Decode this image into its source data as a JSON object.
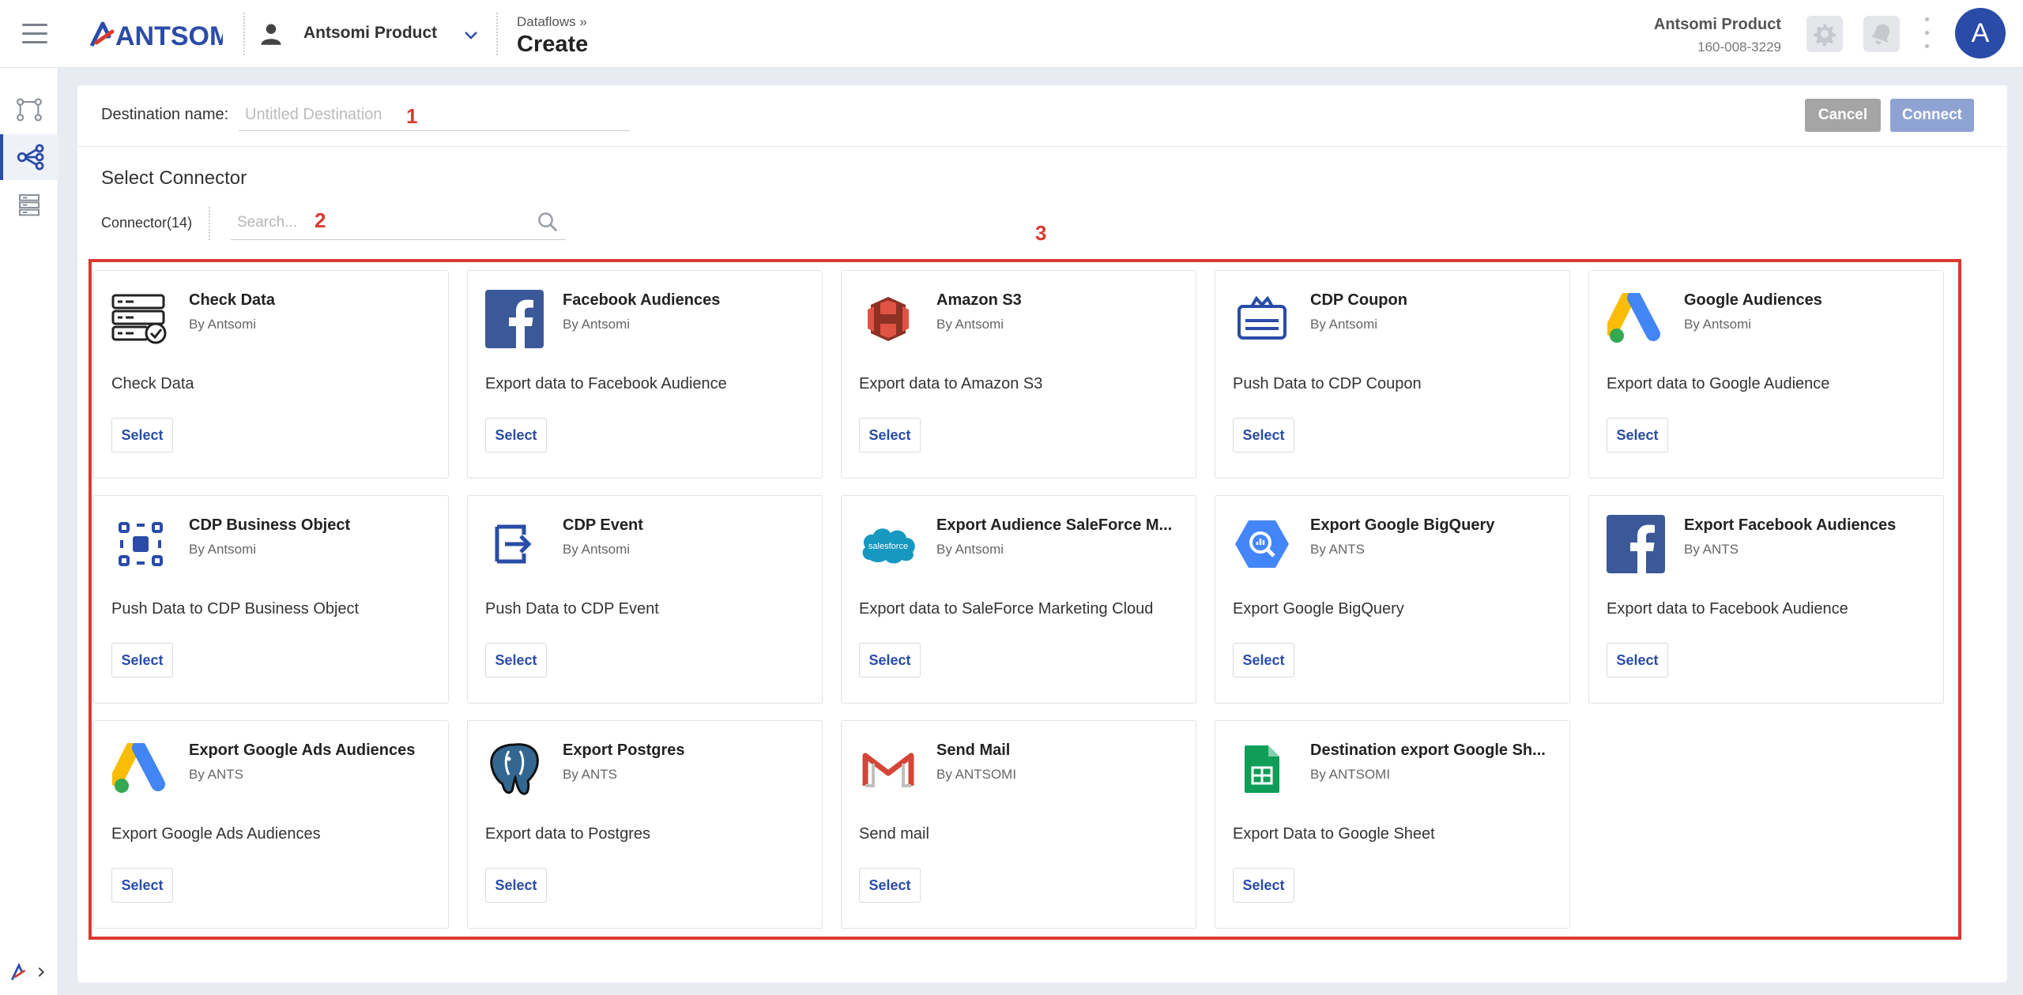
{
  "header": {
    "logo_text": "ANTSOMI",
    "portal_name": "Antsomi Product",
    "breadcrumb": "Dataflows »",
    "page_title": "Create",
    "account_name": "Antsomi Product",
    "account_id": "160-008-3229",
    "avatar_letter": "A"
  },
  "form": {
    "destination_label": "Destination name:",
    "destination_placeholder": "Untitled Destination",
    "cancel_label": "Cancel",
    "connect_label": "Connect"
  },
  "annotations": {
    "a1": "1",
    "a2": "2",
    "a3": "3"
  },
  "connector_section": {
    "title": "Select Connector",
    "count_label": "Connector(14)",
    "search_placeholder": "Search..."
  },
  "colors": {
    "accent": "#2a4ca8",
    "annotation": "#d93a2f"
  },
  "connectors": [
    {
      "title": "Check Data",
      "by": "By Antsomi",
      "description": "Check Data",
      "button": "Select",
      "icon": "check-data-icon"
    },
    {
      "title": "Facebook Audiences",
      "by": "By Antsomi",
      "description": "Export data to Facebook Audience",
      "button": "Select",
      "icon": "facebook-icon"
    },
    {
      "title": "Amazon S3",
      "by": "By Antsomi",
      "description": "Export data to Amazon S3",
      "button": "Select",
      "icon": "amazon-s3-icon"
    },
    {
      "title": "CDP Coupon",
      "by": "By Antsomi",
      "description": "Push Data to CDP Coupon",
      "button": "Select",
      "icon": "coupon-icon"
    },
    {
      "title": "Google Audiences",
      "by": "By Antsomi",
      "description": "Export data to Google Audience",
      "button": "Select",
      "icon": "google-ads-icon"
    },
    {
      "title": "CDP Business Object",
      "by": "By Antsomi",
      "description": "Push Data to CDP Business Object",
      "button": "Select",
      "icon": "business-object-icon"
    },
    {
      "title": "CDP Event",
      "by": "By Antsomi",
      "description": "Push Data to CDP Event",
      "button": "Select",
      "icon": "event-icon"
    },
    {
      "title": "Export Audience SaleForce M...",
      "by": "By Antsomi",
      "description": "Export data to SaleForce Marketing Cloud",
      "button": "Select",
      "icon": "salesforce-icon",
      "icon_text": "salesforce"
    },
    {
      "title": "Export Google BigQuery",
      "by": "By ANTS",
      "description": "Export Google BigQuery",
      "button": "Select",
      "icon": "bigquery-icon"
    },
    {
      "title": "Export Facebook Audiences",
      "by": "By ANTS",
      "description": "Export data to Facebook Audience",
      "button": "Select",
      "icon": "facebook-icon"
    },
    {
      "title": "Export Google Ads Audiences",
      "by": "By ANTS",
      "description": "Export Google Ads Audiences",
      "button": "Select",
      "icon": "google-ads-icon"
    },
    {
      "title": "Export Postgres",
      "by": "By ANTS",
      "description": "Export data to Postgres",
      "button": "Select",
      "icon": "postgres-icon"
    },
    {
      "title": "Send Mail",
      "by": "By ANTSOMI",
      "description": "Send mail",
      "button": "Select",
      "icon": "gmail-icon"
    },
    {
      "title": "Destination export Google Sh...",
      "by": "By ANTSOMI",
      "description": "Export Data to Google Sheet",
      "button": "Select",
      "icon": "google-sheets-icon"
    }
  ]
}
